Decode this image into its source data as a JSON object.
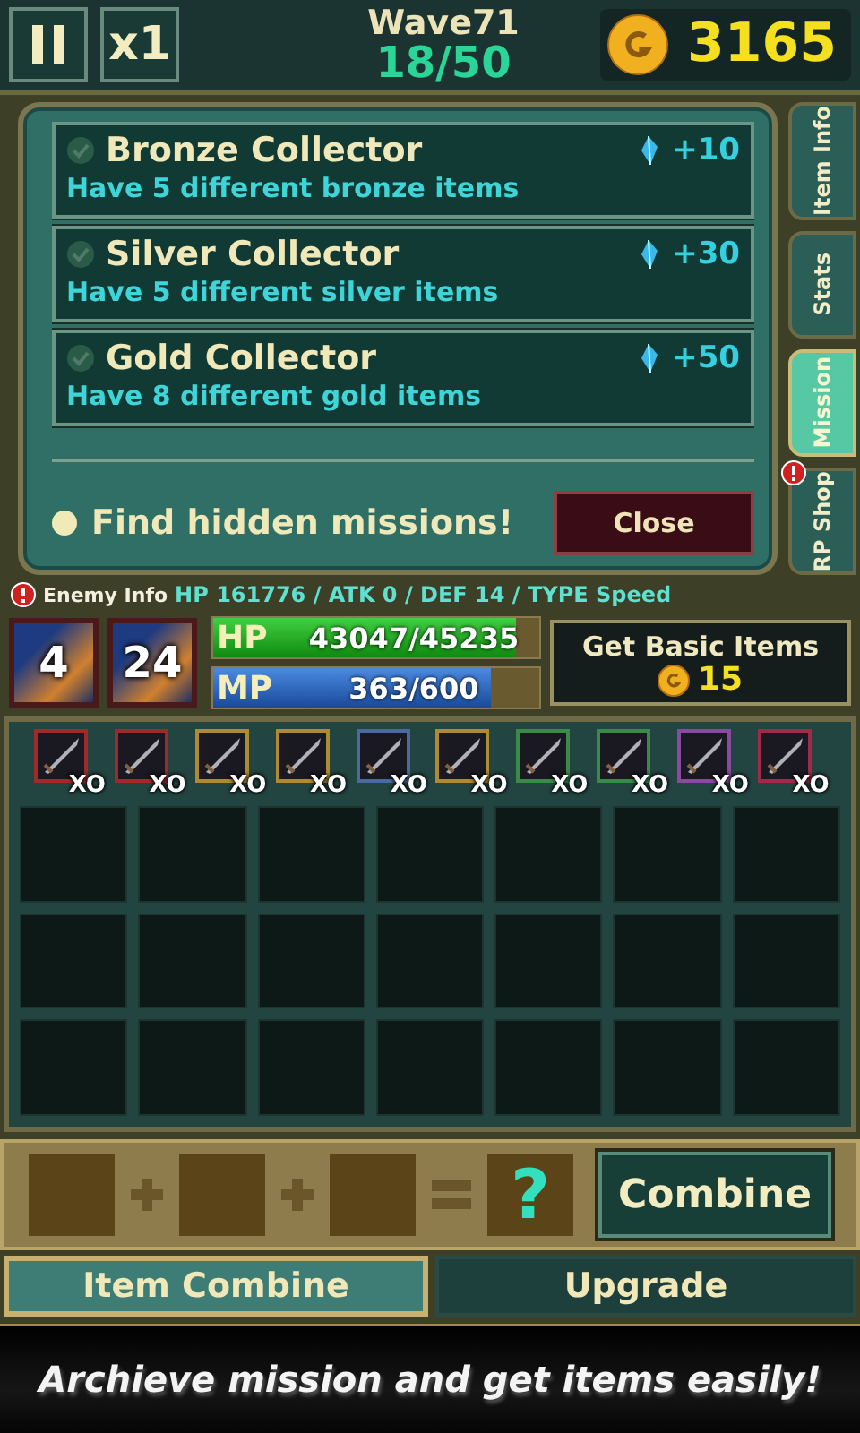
{
  "top_bar": {
    "speed": "x1",
    "wave": "Wave71",
    "progress": "18/50",
    "gold": "3165"
  },
  "missions": [
    {
      "title": "Bronze Collector",
      "description": "Have 5 different bronze items",
      "reward": "+10",
      "completed": false
    },
    {
      "title": "Silver Collector",
      "description": "Have 5 different silver items",
      "reward": "+30",
      "completed": false
    },
    {
      "title": "Gold Collector",
      "description": "Have 8 different gold items",
      "reward": "+50",
      "completed": false
    }
  ],
  "hint": "Find hidden missions!",
  "close_button": "Close",
  "side_tabs": [
    {
      "label": "Item Info",
      "selected": false,
      "alert": false
    },
    {
      "label": "Stats",
      "selected": false,
      "alert": false
    },
    {
      "label": "Mission",
      "selected": true,
      "alert": false
    },
    {
      "label": "RP Shop",
      "selected": false,
      "alert": true
    }
  ],
  "enemy_info": {
    "label": "Enemy Info",
    "stats": "HP 161776 / ATK 0 / DEF 14 / TYPE Speed"
  },
  "skills": [
    {
      "count": "4"
    },
    {
      "count": "24"
    }
  ],
  "hp": {
    "label": "HP",
    "reading": "43047/45235",
    "level": 0.93
  },
  "mp": {
    "label": "MP",
    "reading": "363/600",
    "level": 0.85
  },
  "basic_items": {
    "label": "Get Basic Items",
    "cost": "15"
  },
  "items": [
    {
      "count": "XO",
      "color": "#a02a2a"
    },
    {
      "count": "XO",
      "color": "#a02a2a"
    },
    {
      "count": "XO",
      "color": "#b08a30"
    },
    {
      "count": "XO",
      "color": "#b08a30"
    },
    {
      "count": "XO",
      "color": "#4a6aa0"
    },
    {
      "count": "XO",
      "color": "#b08a30"
    },
    {
      "count": "XO",
      "color": "#3a8a4a"
    },
    {
      "count": "XO",
      "color": "#3a8a4a"
    },
    {
      "count": "XO",
      "color": "#8a4aa0"
    },
    {
      "count": "XO",
      "color": "#a02a4a"
    }
  ],
  "combine": {
    "result": "?",
    "button": "Combine"
  },
  "bottom_tabs": [
    {
      "label": "Item Combine",
      "selected": true
    },
    {
      "label": "Upgrade",
      "selected": false
    }
  ],
  "banner": "Archieve mission and get items easily!"
}
